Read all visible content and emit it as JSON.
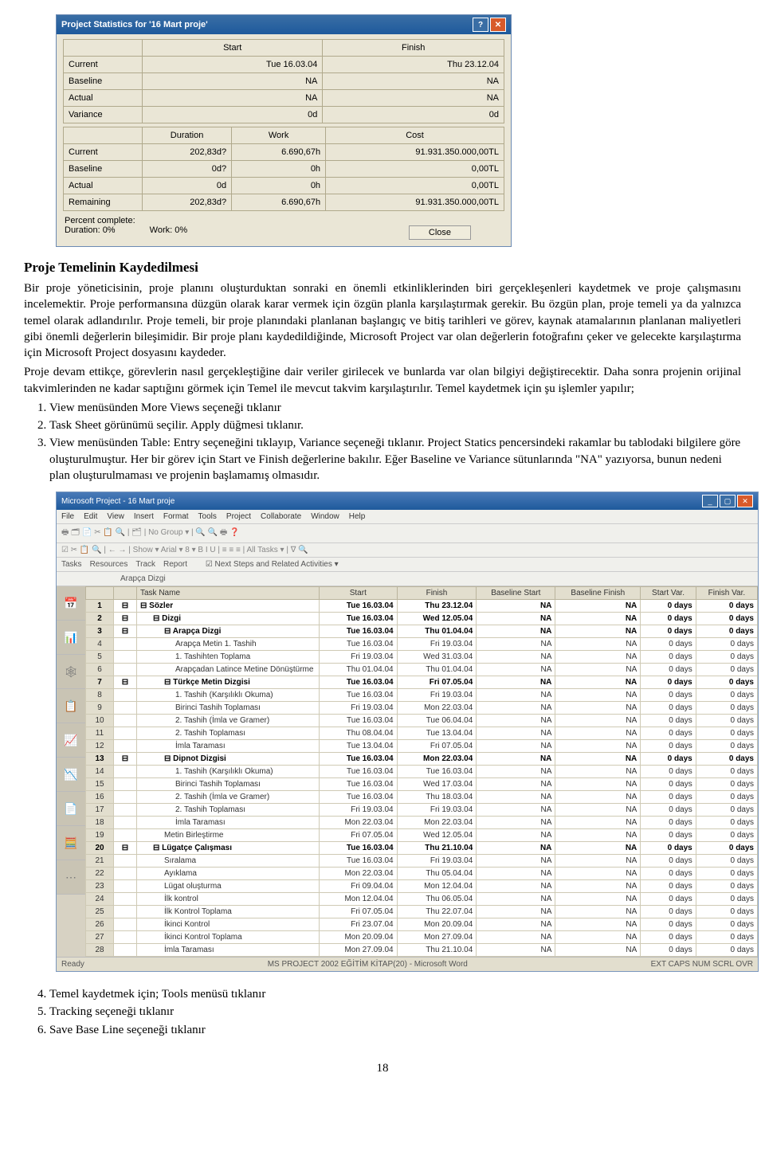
{
  "dialog": {
    "title": "Project Statistics for '16 Mart proje'",
    "table1": {
      "headers": [
        "",
        "Start",
        "Finish"
      ],
      "rows": [
        {
          "label": "Current",
          "start": "Tue 16.03.04",
          "finish": "Thu 23.12.04"
        },
        {
          "label": "Baseline",
          "start": "NA",
          "finish": "NA"
        },
        {
          "label": "Actual",
          "start": "NA",
          "finish": "NA"
        },
        {
          "label": "Variance",
          "start": "0d",
          "finish": "0d"
        }
      ]
    },
    "table2": {
      "headers": [
        "",
        "Duration",
        "Work",
        "Cost"
      ],
      "rows": [
        {
          "label": "Current",
          "dur": "202,83d?",
          "work": "6.690,67h",
          "cost": "91.931.350.000,00TL"
        },
        {
          "label": "Baseline",
          "dur": "0d?",
          "work": "0h",
          "cost": "0,00TL"
        },
        {
          "label": "Actual",
          "dur": "0d",
          "work": "0h",
          "cost": "0,00TL"
        },
        {
          "label": "Remaining",
          "dur": "202,83d?",
          "work": "6.690,67h",
          "cost": "91.931.350.000,00TL"
        }
      ]
    },
    "pc_label": "Percent complete:",
    "pc_duration": "Duration:   0%",
    "pc_work": "Work:   0%",
    "close": "Close"
  },
  "doc": {
    "h": "Proje Temelinin Kaydedilmesi",
    "p1": "Bir proje yöneticisinin, proje planını oluşturduktan sonraki en önemli etkinliklerinden biri gerçekleşenleri kaydetmek ve proje çalışmasını incelemektir. Proje performansına düzgün olarak karar vermek için özgün planla karşılaştırmak gerekir. Bu özgün plan, proje temeli ya da yalnızca temel olarak adlandırılır.    Proje temeli, bir proje planındaki planlanan başlangıç ve bitiş tarihleri ve görev, kaynak atamalarının planlanan maliyetleri gibi önemli değerlerin bileşimidir. Bir proje planı kaydedildiğinde, Microsoft Project var olan değerlerin fotoğrafını çeker ve gelecekte karşılaştırma için Microsoft Project dosyasını kaydeder.",
    "p2": "Proje devam ettikçe, görevlerin nasıl gerçekleştiğine dair veriler girilecek ve bunlarda var olan bilgiyi değiştirecektir. Daha sonra projenin orijinal takvimlerinden ne kadar saptığını görmek için Temel ile mevcut takvim karşılaştırılır.  Temel kaydetmek için şu işlemler yapılır;",
    "ol1": [
      "View menüsünden More Views seçeneği tıklanır",
      "Task Sheet görünümü seçilir. Apply düğmesi tıklanır.",
      "View menüsünden Table: Entry seçeneğini tıklayıp, Variance seçeneği tıklanır. Project Statics pencersindeki rakamlar bu tablodaki bilgilere göre oluşturulmuştur.  Her bir görev için Start ve Finish değerlerine bakılır. Eğer Baseline ve Variance sütunlarında \"NA\" yazıyorsa,  bunun nedeni plan oluşturulmaması ve projenin başlamamış olmasıdır."
    ],
    "ol2": [
      "Temel kaydetmek için; Tools menüsü tıklanır",
      "Tracking seçeneği tıklanır",
      "Save Base Line seçeneği tıklanır"
    ],
    "pagenum": "18"
  },
  "app": {
    "title": "Microsoft Project - 16 Mart proje",
    "menu": [
      "File",
      "Edit",
      "View",
      "Insert",
      "Format",
      "Tools",
      "Project",
      "Collaborate",
      "Window",
      "Help"
    ],
    "tb1": "☑ ✂ 📋 🔍 | ← → | Show ▾  Arial  ▾ 8 ▾ B I U | ≡ ≡ ≡ | All Tasks ▾ | ∇ 🔍",
    "tb2": "🖶 🗂 📄 ✂ 📋 🔍 | 🗂 | No Group ▾ | 🔍 🔍 🖶 ❓",
    "tabs": [
      "Tasks",
      "Resources",
      "Track",
      "Report"
    ],
    "tabs_extra": "☑  Next Steps and Related Activities ▾",
    "sub": "Arapça Dizgi",
    "cols": [
      "",
      "",
      "Task Name",
      "Start",
      "Finish",
      "Baseline Start",
      "Baseline Finish",
      "Start Var.",
      "Finish Var."
    ],
    "rows": [
      {
        "n": "1",
        "bold": true,
        "ind": 0,
        "icon": "⊟",
        "name": "Sözler",
        "s": "Tue 16.03.04",
        "f": "Thu 23.12.04",
        "bs": "NA",
        "bf": "NA",
        "sv": "0 days",
        "fv": "0 days"
      },
      {
        "n": "2",
        "bold": true,
        "ind": 1,
        "icon": "⊟",
        "name": "Dizgi",
        "s": "Tue 16.03.04",
        "f": "Wed 12.05.04",
        "bs": "NA",
        "bf": "NA",
        "sv": "0 days",
        "fv": "0 days"
      },
      {
        "n": "3",
        "bold": true,
        "ind": 2,
        "icon": "⊟",
        "name": "Arapça Dizgi",
        "s": "Tue 16.03.04",
        "f": "Thu 01.04.04",
        "bs": "NA",
        "bf": "NA",
        "sv": "0 days",
        "fv": "0 days"
      },
      {
        "n": "4",
        "bold": false,
        "ind": 3,
        "icon": "",
        "name": "Arapça Metin 1. Tashih",
        "s": "Tue 16.03.04",
        "f": "Fri 19.03.04",
        "bs": "NA",
        "bf": "NA",
        "sv": "0 days",
        "fv": "0 days"
      },
      {
        "n": "5",
        "bold": false,
        "ind": 3,
        "icon": "",
        "name": "1. Tashihten Toplama",
        "s": "Fri 19.03.04",
        "f": "Wed 31.03.04",
        "bs": "NA",
        "bf": "NA",
        "sv": "0 days",
        "fv": "0 days"
      },
      {
        "n": "6",
        "bold": false,
        "ind": 3,
        "icon": "",
        "name": "Arapçadan Latince Metine Dönüştürme",
        "s": "Thu 01.04.04",
        "f": "Thu 01.04.04",
        "bs": "NA",
        "bf": "NA",
        "sv": "0 days",
        "fv": "0 days"
      },
      {
        "n": "7",
        "bold": true,
        "ind": 2,
        "icon": "⊟",
        "name": "Türkçe Metin Dizgisi",
        "s": "Tue 16.03.04",
        "f": "Fri 07.05.04",
        "bs": "NA",
        "bf": "NA",
        "sv": "0 days",
        "fv": "0 days"
      },
      {
        "n": "8",
        "bold": false,
        "ind": 3,
        "icon": "",
        "name": "1. Tashih (Karşılıklı Okuma)",
        "s": "Tue 16.03.04",
        "f": "Fri 19.03.04",
        "bs": "NA",
        "bf": "NA",
        "sv": "0 days",
        "fv": "0 days"
      },
      {
        "n": "9",
        "bold": false,
        "ind": 3,
        "icon": "",
        "name": "Birinci Tashih Toplaması",
        "s": "Fri 19.03.04",
        "f": "Mon 22.03.04",
        "bs": "NA",
        "bf": "NA",
        "sv": "0 days",
        "fv": "0 days"
      },
      {
        "n": "10",
        "bold": false,
        "ind": 3,
        "icon": "",
        "name": "2. Tashih (İmla ve Gramer)",
        "s": "Tue 16.03.04",
        "f": "Tue 06.04.04",
        "bs": "NA",
        "bf": "NA",
        "sv": "0 days",
        "fv": "0 days"
      },
      {
        "n": "11",
        "bold": false,
        "ind": 3,
        "icon": "",
        "name": "2. Tashih Toplaması",
        "s": "Thu 08.04.04",
        "f": "Tue 13.04.04",
        "bs": "NA",
        "bf": "NA",
        "sv": "0 days",
        "fv": "0 days"
      },
      {
        "n": "12",
        "bold": false,
        "ind": 3,
        "icon": "",
        "name": "İmla Taraması",
        "s": "Tue 13.04.04",
        "f": "Fri 07.05.04",
        "bs": "NA",
        "bf": "NA",
        "sv": "0 days",
        "fv": "0 days"
      },
      {
        "n": "13",
        "bold": true,
        "ind": 2,
        "icon": "⊟",
        "name": "Dipnot Dizgisi",
        "s": "Tue 16.03.04",
        "f": "Mon 22.03.04",
        "bs": "NA",
        "bf": "NA",
        "sv": "0 days",
        "fv": "0 days"
      },
      {
        "n": "14",
        "bold": false,
        "ind": 3,
        "icon": "",
        "name": "1. Tashih (Karşılıklı Okuma)",
        "s": "Tue 16.03.04",
        "f": "Tue 16.03.04",
        "bs": "NA",
        "bf": "NA",
        "sv": "0 days",
        "fv": "0 days"
      },
      {
        "n": "15",
        "bold": false,
        "ind": 3,
        "icon": "",
        "name": "Birinci Tashih Toplaması",
        "s": "Tue 16.03.04",
        "f": "Wed 17.03.04",
        "bs": "NA",
        "bf": "NA",
        "sv": "0 days",
        "fv": "0 days"
      },
      {
        "n": "16",
        "bold": false,
        "ind": 3,
        "icon": "",
        "name": "2. Tashih (İmla ve Gramer)",
        "s": "Tue 16.03.04",
        "f": "Thu 18.03.04",
        "bs": "NA",
        "bf": "NA",
        "sv": "0 days",
        "fv": "0 days"
      },
      {
        "n": "17",
        "bold": false,
        "ind": 3,
        "icon": "",
        "name": "2. Tashih Toplaması",
        "s": "Fri 19.03.04",
        "f": "Fri 19.03.04",
        "bs": "NA",
        "bf": "NA",
        "sv": "0 days",
        "fv": "0 days"
      },
      {
        "n": "18",
        "bold": false,
        "ind": 3,
        "icon": "",
        "name": "İmla Taraması",
        "s": "Mon 22.03.04",
        "f": "Mon 22.03.04",
        "bs": "NA",
        "bf": "NA",
        "sv": "0 days",
        "fv": "0 days"
      },
      {
        "n": "19",
        "bold": false,
        "ind": 2,
        "icon": "",
        "name": "Metin Birleştirme",
        "s": "Fri 07.05.04",
        "f": "Wed 12.05.04",
        "bs": "NA",
        "bf": "NA",
        "sv": "0 days",
        "fv": "0 days"
      },
      {
        "n": "20",
        "bold": true,
        "ind": 1,
        "icon": "⊟",
        "name": "Lügatçe Çalışması",
        "s": "Tue 16.03.04",
        "f": "Thu 21.10.04",
        "bs": "NA",
        "bf": "NA",
        "sv": "0 days",
        "fv": "0 days"
      },
      {
        "n": "21",
        "bold": false,
        "ind": 2,
        "icon": "",
        "name": "Sıralama",
        "s": "Tue 16.03.04",
        "f": "Fri 19.03.04",
        "bs": "NA",
        "bf": "NA",
        "sv": "0 days",
        "fv": "0 days"
      },
      {
        "n": "22",
        "bold": false,
        "ind": 2,
        "icon": "",
        "name": "Ayıklama",
        "s": "Mon 22.03.04",
        "f": "Thu 05.04.04",
        "bs": "NA",
        "bf": "NA",
        "sv": "0 days",
        "fv": "0 days"
      },
      {
        "n": "23",
        "bold": false,
        "ind": 2,
        "icon": "",
        "name": "Lügat oluşturma",
        "s": "Fri 09.04.04",
        "f": "Mon 12.04.04",
        "bs": "NA",
        "bf": "NA",
        "sv": "0 days",
        "fv": "0 days"
      },
      {
        "n": "24",
        "bold": false,
        "ind": 2,
        "icon": "",
        "name": "İlk kontrol",
        "s": "Mon 12.04.04",
        "f": "Thu 06.05.04",
        "bs": "NA",
        "bf": "NA",
        "sv": "0 days",
        "fv": "0 days"
      },
      {
        "n": "25",
        "bold": false,
        "ind": 2,
        "icon": "",
        "name": "İlk Kontrol Toplama",
        "s": "Fri 07.05.04",
        "f": "Thu 22.07.04",
        "bs": "NA",
        "bf": "NA",
        "sv": "0 days",
        "fv": "0 days"
      },
      {
        "n": "26",
        "bold": false,
        "ind": 2,
        "icon": "",
        "name": "İkinci Kontrol",
        "s": "Fri 23.07.04",
        "f": "Mon 20.09.04",
        "bs": "NA",
        "bf": "NA",
        "sv": "0 days",
        "fv": "0 days"
      },
      {
        "n": "27",
        "bold": false,
        "ind": 2,
        "icon": "",
        "name": "İkinci Kontrol Toplama",
        "s": "Mon 20.09.04",
        "f": "Mon 27.09.04",
        "bs": "NA",
        "bf": "NA",
        "sv": "0 days",
        "fv": "0 days"
      },
      {
        "n": "28",
        "bold": false,
        "ind": 2,
        "icon": "",
        "name": "İmla Taraması",
        "s": "Mon 27.09.04",
        "f": "Thu 21.10.04",
        "bs": "NA",
        "bf": "NA",
        "sv": "0 days",
        "fv": "0 days"
      }
    ],
    "status_left": "Ready",
    "status_center": "MS PROJECT 2002 EĞİTİM KİTAP(20) - Microsoft Word",
    "status_right": "EXT   CAPS   NUM   SCRL   OVR"
  }
}
